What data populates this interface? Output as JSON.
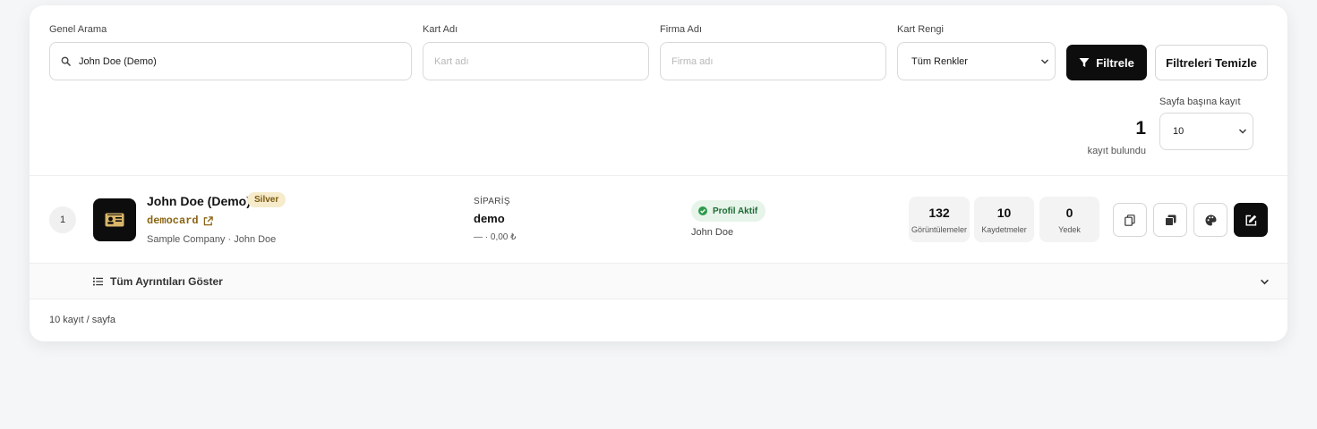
{
  "filters": {
    "general_search": {
      "label": "Genel Arama",
      "value": "John Doe (Demo)"
    },
    "card_name": {
      "label": "Kart Adı",
      "placeholder": "Kart adı"
    },
    "company_name": {
      "label": "Firma Adı",
      "placeholder": "Firma adı"
    },
    "card_color": {
      "label": "Kart Rengi",
      "selected": "Tüm Renkler"
    },
    "filter_button": "Filtrele",
    "clear_button": "Filtreleri Temizle"
  },
  "results": {
    "count": "1",
    "count_label": "kayıt bulundu",
    "per_page_label": "Sayfa başına kayıt",
    "per_page_selected": "10"
  },
  "rows": [
    {
      "index": "1",
      "name": "John Doe (Demo)",
      "tier": "Silver",
      "slug": "democard",
      "meta": "Sample Company · John Doe",
      "order_label": "SİPARİŞ",
      "order_value": "demo",
      "order_price": "— · 0,00 ₺",
      "status": "Profil Aktif",
      "owner": "John Doe",
      "stats": [
        {
          "value": "132",
          "label": "Görüntülemeler"
        },
        {
          "value": "10",
          "label": "Kaydetmeler"
        },
        {
          "value": "0",
          "label": "Yedek"
        }
      ]
    }
  ],
  "details_toggle": "Tüm Ayrıntıları Göster",
  "footer": "10 kayıt / sayfa",
  "colors": {
    "accent_dark": "#0d0d0d",
    "silver_badge": "#f6ebcb",
    "status_green": "#1d6b33",
    "slug_gold": "#8a6412"
  }
}
